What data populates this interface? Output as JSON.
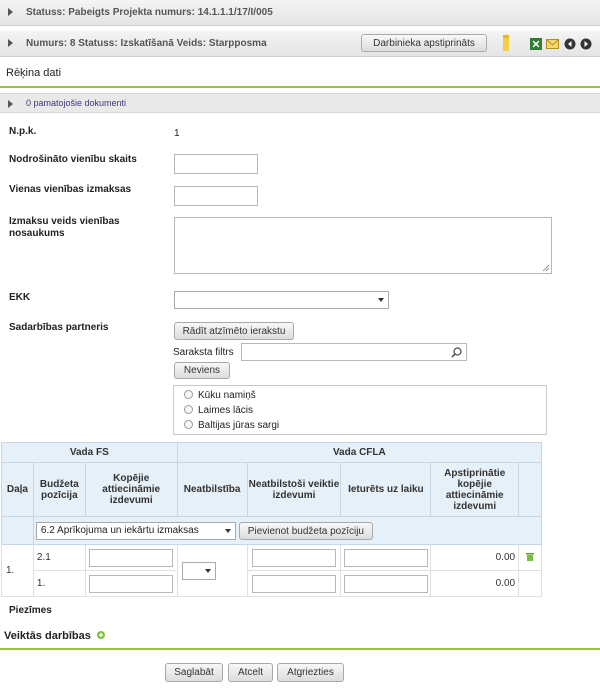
{
  "header1": {
    "text": "Statuss: Pabeigts   Projekta numurs: 14.1.1.1/17/I/005"
  },
  "header2": {
    "text": "Numurs: 8   Statuss: Izskatīšanā   Veids: Starpposma",
    "approve_button": "Darbinieka apstiprināts"
  },
  "page_title": "Rēķina dati",
  "docs_bar": "0 pamatojošie dokumenti",
  "form": {
    "npk_label": "N.p.k.",
    "npk_value": "1",
    "units_label": "Nodrošināto vienību skaits",
    "unit_cost_label": "Vienas vienības izmaksas",
    "cost_type_label": "Izmaksu veids vienības nosaukums",
    "ekk_label": "EKK",
    "partners_label": "Sadarbības partneris",
    "show_selected_button": "Rādīt atzīmēto ierakstu",
    "filter_label": "Saraksta filtrs",
    "none_button": "Neviens",
    "partners": [
      "Kūku namiņš",
      "Laimes lācis",
      "Baltijas jūras sargi"
    ]
  },
  "table": {
    "group_fs": "Vada FS",
    "group_cfla": "Vada CFLA",
    "headers": [
      "Daļa",
      "Budžeta pozīcija",
      "Kopējie attiecināmie izdevumi",
      "Neatbilstība",
      "Neatbilstoši veiktie izdevumi",
      "Ieturēts uz laiku",
      "Apstiprinātie kopējie attiecināmie izdevumi"
    ],
    "budget_select": "6.2 Aprīkojuma un iekārtu izmaksas",
    "add_button": "Pievienot budžeta pozīciju",
    "part": "1.",
    "rows": [
      {
        "position": "2.1",
        "approved": "0.00"
      },
      {
        "position": "1.",
        "approved": "0.00"
      }
    ]
  },
  "notes_label": "Piezīmes",
  "actions_label": "Veiktās darbības",
  "footer": {
    "save": "Saglabāt",
    "cancel": "Atcelt",
    "back": "Atgriezties"
  },
  "colors": {
    "accent": "#99c33c",
    "table_header": "#e6f0f8"
  }
}
